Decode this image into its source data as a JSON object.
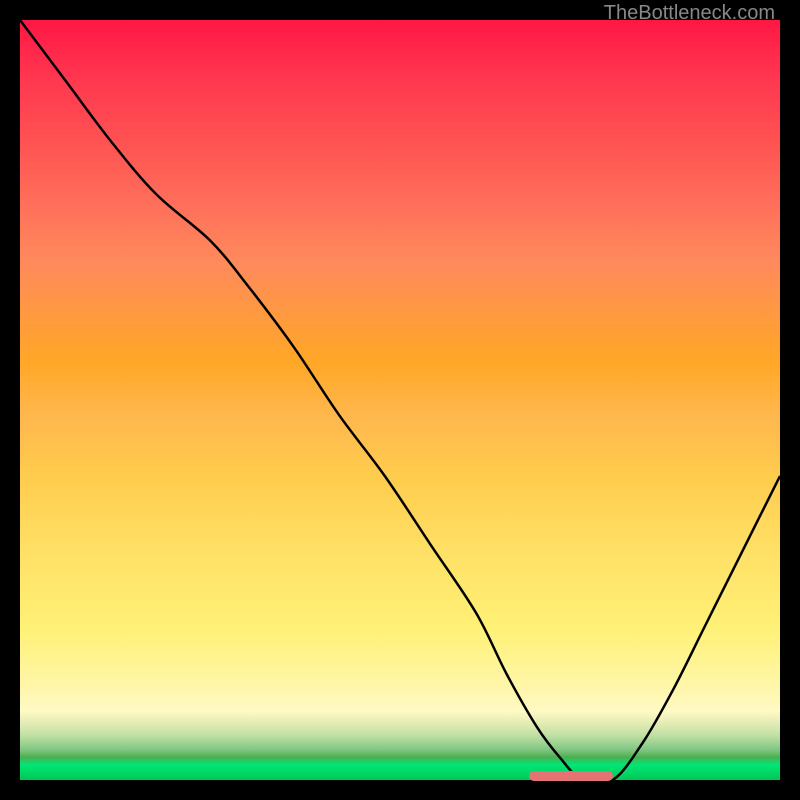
{
  "watermark": "TheBottleneck.com",
  "chart_data": {
    "type": "line",
    "title": "",
    "xlabel": "",
    "ylabel": "",
    "xlim": [
      0,
      100
    ],
    "ylim": [
      0,
      100
    ],
    "background_gradient": {
      "top_color": "#ff1744",
      "mid_color": "#ffcc4d",
      "bottom_color": "#00c853"
    },
    "series": [
      {
        "name": "bottleneck-curve",
        "x": [
          0,
          6,
          12,
          18,
          25,
          30,
          36,
          42,
          48,
          54,
          60,
          64,
          68,
          71,
          74,
          78,
          82,
          86,
          90,
          94,
          100
        ],
        "values": [
          100,
          92,
          84,
          77,
          71,
          65,
          57,
          48,
          40,
          31,
          22,
          14,
          7,
          3,
          0,
          0,
          5,
          12,
          20,
          28,
          40
        ]
      }
    ],
    "marker": {
      "x_start": 67,
      "x_end": 78,
      "y": 0.5,
      "color": "#e57373"
    },
    "grid": false,
    "legend": false
  }
}
